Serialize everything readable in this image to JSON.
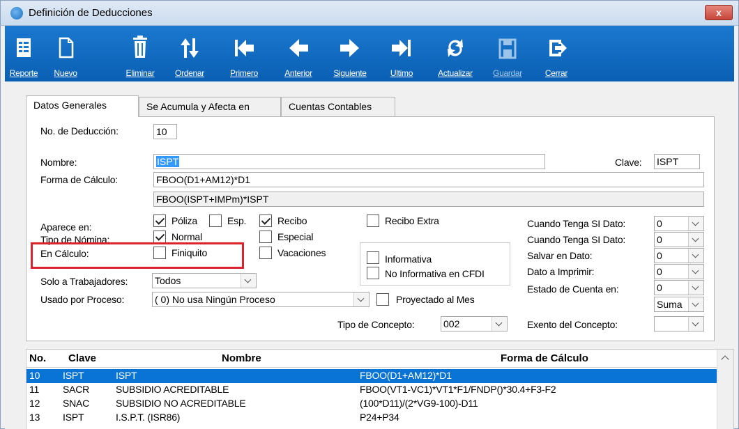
{
  "window": {
    "title": "Definición de Deducciones",
    "close": "x"
  },
  "toolbar": {
    "buttons": [
      {
        "label": "Reporte",
        "icon": "report-icon"
      },
      {
        "label": "Nuevo",
        "icon": "new-icon"
      },
      {
        "label": "Eliminar",
        "icon": "trash-icon"
      },
      {
        "label": "Ordenar",
        "icon": "sort-icon"
      },
      {
        "label": "Primero",
        "icon": "first-icon"
      },
      {
        "label": "Anterior",
        "icon": "previous-icon"
      },
      {
        "label": "Siguiente",
        "icon": "next-icon"
      },
      {
        "label": "Ultimo",
        "icon": "last-icon"
      },
      {
        "label": "Actualizar",
        "icon": "refresh-icon"
      },
      {
        "label": "Guardar",
        "icon": "save-icon"
      },
      {
        "label": "Cerrar",
        "icon": "exit-icon"
      }
    ]
  },
  "tabs": [
    "Datos Generales",
    "Se Acumula y Afecta en",
    "Cuentas Contables"
  ],
  "form": {
    "no_deduccion_label": "No. de Deducción:",
    "no_deduccion_value": "10",
    "nombre_label": "Nombre:",
    "nombre_value": "ISPT",
    "clave_label": "Clave:",
    "clave_value": "ISPT",
    "forma_calculo_label": "Forma de Cálculo:",
    "forma_calculo_value": "FBOO(D1+AM12)*D1",
    "forma_calculo_2": "FBOO(ISPT+IMPm)*ISPT",
    "aparece_en_label": "Aparece en:",
    "tipo_nomina_label": "Tipo de Nómina:",
    "en_calculo_label": "En Cálculo:",
    "poliza": "Póliza",
    "esp": "Esp.",
    "recibo": "Recibo",
    "recibo_extra": "Recibo Extra",
    "normal": "Normal",
    "especial": "Especial",
    "finiquito": "Finiquito",
    "vacaciones": "Vacaciones",
    "informativa": "Informativa",
    "no_informativa": "No Informativa en CFDI",
    "solo_trabajadores_label": "Solo a Trabajadores:",
    "solo_trabajadores_value": "Todos",
    "usado_proceso_label": "Usado por Proceso:",
    "usado_proceso_value": "( 0) No usa Ningún Proceso",
    "proyectado": "Proyectado al Mes",
    "tipo_concepto_label": "Tipo de Concepto:",
    "tipo_concepto_value": "002",
    "exento_label": "Exento del Concepto:",
    "exento_value": "",
    "cuando1_label": "Cuando Tenga SI Dato:",
    "cuando1_value": "0",
    "cuando2_label": "Cuando Tenga SI Dato:",
    "cuando2_value": "0",
    "salvar_label": "Salvar en Dato:",
    "salvar_value": "0",
    "dato_imprimir_label": "Dato a Imprimir:",
    "dato_imprimir_value": "0",
    "estado_cuenta_label": "Estado de Cuenta en:",
    "estado_cuenta_value": "0",
    "suma_value": "Suma"
  },
  "grid": {
    "headers": [
      "No.",
      "Clave",
      "Nombre",
      "Forma de Cálculo"
    ],
    "rows": [
      [
        "10",
        "ISPT",
        "ISPT",
        "FBOO(D1+AM12)*D1"
      ],
      [
        "11",
        "SACR",
        "SUBSIDIO ACREDITABLE",
        "FBOO(VT1-VC1)*VT1*F1/FNDP()*30.4+F3-F2"
      ],
      [
        "12",
        "SNAC",
        "SUBSIDIO NO ACREDITABLE",
        "(100*D11)/(2*VG9-100)-D11"
      ],
      [
        "13",
        "ISPT",
        "I.S.P.T. (ISR86)",
        "P24+P34"
      ]
    ]
  },
  "colors": {
    "toolbar": "#0a5fb3",
    "selected_row": "#0a74d6",
    "highlight_box": "#d9232e"
  }
}
